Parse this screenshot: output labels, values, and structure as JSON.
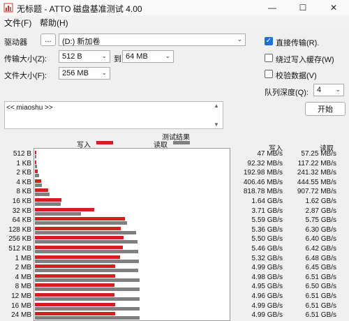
{
  "window": {
    "title": "无标题 - ATTO 磁盘基准测试 4.00",
    "minimize": "—",
    "maximize": "☐",
    "close": "✕"
  },
  "menu": [
    "文件(F)",
    "帮助(H)"
  ],
  "drive": {
    "label": "驱动器",
    "browse": "...",
    "value": "(D:) 新加卷"
  },
  "transfer": {
    "label": "传输大小(Z):",
    "from": "512 B",
    "to_label": "到",
    "to": "64 MB"
  },
  "filesize": {
    "label": "文件大小(F):",
    "value": "256 MB"
  },
  "options": {
    "direct": {
      "label": "直接传输(R).",
      "checked": true
    },
    "bypass": {
      "label": "绕过写入缓存(W)",
      "checked": false
    },
    "verify": {
      "label": "校验数据(V)",
      "checked": false
    }
  },
  "queue": {
    "label": "队列深度(Q):",
    "value": "4"
  },
  "start_button": "开始",
  "description": "<< miaoshu >>",
  "results": {
    "title": "测试结果",
    "write_legend": "写入",
    "read_legend": "读取",
    "write_header": "写入",
    "read_header": "读取"
  },
  "colors": {
    "write": "#d02020",
    "read": "#808080",
    "accent": "#1a6fd8"
  },
  "chart_data": {
    "type": "bar",
    "orientation": "horizontal",
    "x_unit": "MB/s",
    "series": [
      {
        "name": "写入",
        "values": [
          47,
          92.32,
          192.98,
          406.46,
          818.78,
          1640,
          3710,
          5590,
          5360,
          5500,
          5460,
          5320,
          4990,
          4980,
          4950,
          4960,
          4990,
          4990
        ]
      },
      {
        "name": "读取",
        "values": [
          57.25,
          117.22,
          241.32,
          444.55,
          907.72,
          1620,
          2870,
          5750,
          6300,
          6400,
          6420,
          6480,
          6450,
          6510,
          6500,
          6510,
          6510,
          6510
        ]
      }
    ],
    "xlim": [
      0,
      10000
    ]
  },
  "rows": [
    {
      "size": "512 B",
      "write": "47 MB/s",
      "read": "57.25 MB/s"
    },
    {
      "size": "1 KB",
      "write": "92.32 MB/s",
      "read": "117.22 MB/s"
    },
    {
      "size": "2 KB",
      "write": "192.98 MB/s",
      "read": "241.32 MB/s"
    },
    {
      "size": "4 KB",
      "write": "406.46 MB/s",
      "read": "444.55 MB/s"
    },
    {
      "size": "8 KB",
      "write": "818.78 MB/s",
      "read": "907.72 MB/s"
    },
    {
      "size": "16 KB",
      "write": "1.64 GB/s",
      "read": "1.62 GB/s"
    },
    {
      "size": "32 KB",
      "write": "3.71 GB/s",
      "read": "2.87 GB/s"
    },
    {
      "size": "64 KB",
      "write": "5.59 GB/s",
      "read": "5.75 GB/s"
    },
    {
      "size": "128 KB",
      "write": "5.36 GB/s",
      "read": "6.30 GB/s"
    },
    {
      "size": "256 KB",
      "write": "5.50 GB/s",
      "read": "6.40 GB/s"
    },
    {
      "size": "512 KB",
      "write": "5.46 GB/s",
      "read": "6.42 GB/s"
    },
    {
      "size": "1 MB",
      "write": "5.32 GB/s",
      "read": "6.48 GB/s"
    },
    {
      "size": "2 MB",
      "write": "4.99 GB/s",
      "read": "6.45 GB/s"
    },
    {
      "size": "4 MB",
      "write": "4.98 GB/s",
      "read": "6.51 GB/s"
    },
    {
      "size": "8 MB",
      "write": "4.95 GB/s",
      "read": "6.50 GB/s"
    },
    {
      "size": "12 MB",
      "write": "4.96 GB/s",
      "read": "6.51 GB/s"
    },
    {
      "size": "16 MB",
      "write": "4.99 GB/s",
      "read": "6.51 GB/s"
    },
    {
      "size": "24 MB",
      "write": "4.99 GB/s",
      "read": "6.51 GB/s"
    }
  ]
}
